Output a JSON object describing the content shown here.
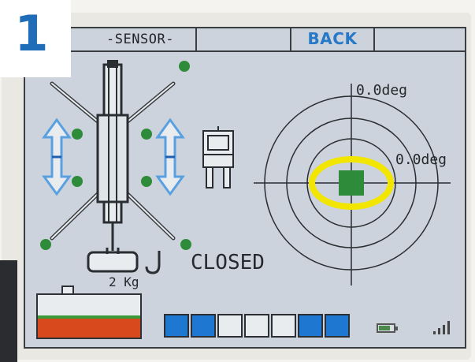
{
  "badge": {
    "number": "1"
  },
  "topbar": {
    "sensor_label": "-SENSOR-",
    "back_label": "BACK"
  },
  "crane": {
    "hook_state": "CLOSED",
    "load": "2 Kg"
  },
  "tilt": {
    "x_reading": "0.0deg",
    "y_reading": "0.0deg"
  },
  "status": {
    "fuel_level_fraction": 0.45,
    "segments": [
      "blue",
      "blue",
      "empty",
      "empty",
      "empty",
      "blue",
      "blue"
    ]
  },
  "colors": {
    "accent_blue": "#2878c8",
    "badge_blue": "#1f6db8",
    "status_green": "#2e8b3a",
    "highlight_yellow": "#f2e600",
    "segment_blue": "#1e78d2",
    "fuel_green": "#3a9a3a",
    "fuel_red": "#d84a1e",
    "arrow_blue": "#5aa0e0"
  }
}
